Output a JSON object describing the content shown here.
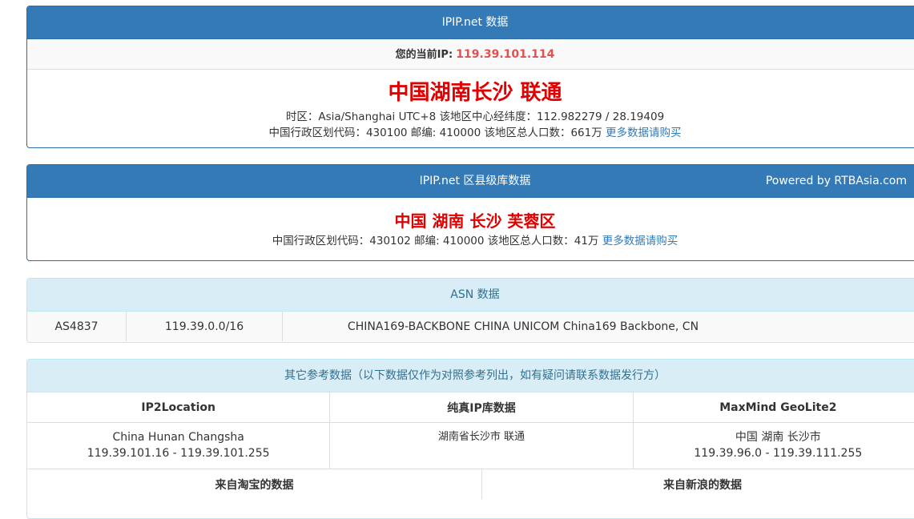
{
  "ipip": {
    "title": "IPIP.net 数据",
    "current_ip_label": "您的当前IP:",
    "current_ip": "119.39.101.114",
    "location": "中国湖南长沙 联通",
    "timezone_line": "时区：Asia/Shanghai UTC+8 该地区中心经纬度：112.982279 / 28.19409",
    "admin_line": "中国行政区划代码：430100 邮编: 410000 该地区总人口数：661万",
    "more_link": "更多数据请购买"
  },
  "district": {
    "title": "IPIP.net 区县级库数据",
    "powered_by": "Powered by RTBAsia.com",
    "location": "中国 湖南 长沙 芙蓉区",
    "admin_line": "中国行政区划代码：430102 邮编: 410000 该地区总人口数：41万",
    "more_link": "更多数据请购买"
  },
  "asn": {
    "title": "ASN 数据",
    "number": "AS4837",
    "prefix": "119.39.0.0/16",
    "name": "CHINA169-BACKBONE CHINA UNICOM China169 Backbone, CN"
  },
  "other": {
    "title": "其它参考数据（以下数据仅作为对照参考列出，如有疑问请联系数据发行方）",
    "headers": [
      "IP2Location",
      "纯真IP库数据",
      "MaxMind GeoLite2"
    ],
    "ip2location": {
      "line1": "China Hunan Changsha",
      "line2": "119.39.101.16 - 119.39.101.255"
    },
    "chunzhen": {
      "line1": "湖南省长沙市 联通"
    },
    "maxmind": {
      "line1": "中国 湖南 长沙市",
      "line2": "119.39.96.0 - 119.39.111.255"
    },
    "headers2": [
      "来自淘宝的数据",
      "来自新浪的数据"
    ]
  }
}
